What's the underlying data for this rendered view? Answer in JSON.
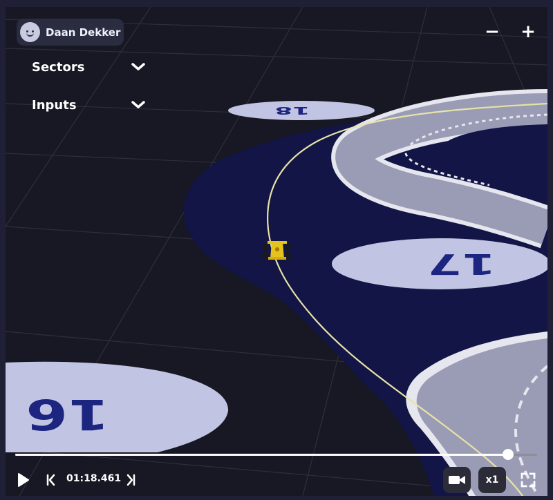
{
  "user": {
    "name": "Daan Dekker",
    "avatar_icon": "smiley-avatar-icon"
  },
  "zoom": {
    "out_label": "−",
    "in_label": "+"
  },
  "panels": [
    {
      "label": "Sectors",
      "icon": "chevron-down-icon"
    },
    {
      "label": "Inputs",
      "icon": "chevron-down-icon"
    }
  ],
  "track": {
    "corner_labels": [
      "18",
      "17",
      "16"
    ],
    "colors": {
      "background": "#171823",
      "runoff": "#121545",
      "track_surface": "#9a9bb5",
      "kerb": "#e5e6ee",
      "marker_disc": "#c2c4e3",
      "marker_text": "#1c2580",
      "racing_line": "#e8e3a6",
      "car": "#e6c21c"
    }
  },
  "playback": {
    "time": "01:18.461",
    "progress_fraction": 0.945,
    "speed_label": "x1",
    "icons": {
      "play": "play-icon",
      "previous": "skip-previous-icon",
      "next": "skip-next-icon",
      "camera": "video-camera-icon",
      "fullscreen": "fullscreen-icon"
    }
  }
}
